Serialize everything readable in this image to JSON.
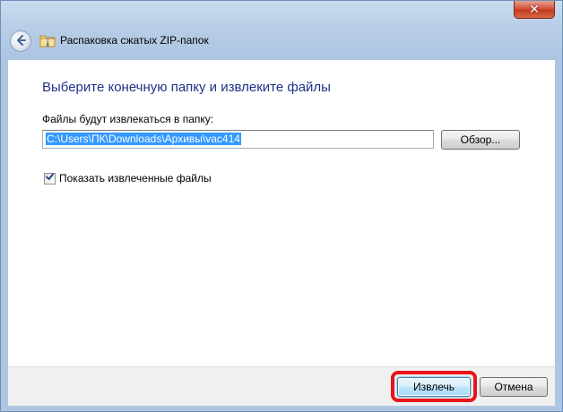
{
  "window": {
    "title": "Распаковка сжатых ZIP-папок",
    "close_glyph": "✕"
  },
  "icons": {
    "back": "back-arrow-icon",
    "zip_folder": "zip-folder-icon",
    "close": "close-icon",
    "check": "checkmark-icon"
  },
  "main": {
    "heading": "Выберите конечную папку и извлеките файлы",
    "dest_label": "Файлы будут извлекаться в папку:",
    "dest_path": "C:\\Users\\ПК\\Downloads\\Архивы\\vac414",
    "browse_label": "Обзор...",
    "show_files_label": "Показать извлеченные файлы",
    "show_files_checked": true
  },
  "footer": {
    "extract_label": "Извлечь",
    "cancel_label": "Отмена"
  },
  "colors": {
    "heading": "#1e3287",
    "highlight": "#e8141c",
    "selection": "#3399ff"
  }
}
